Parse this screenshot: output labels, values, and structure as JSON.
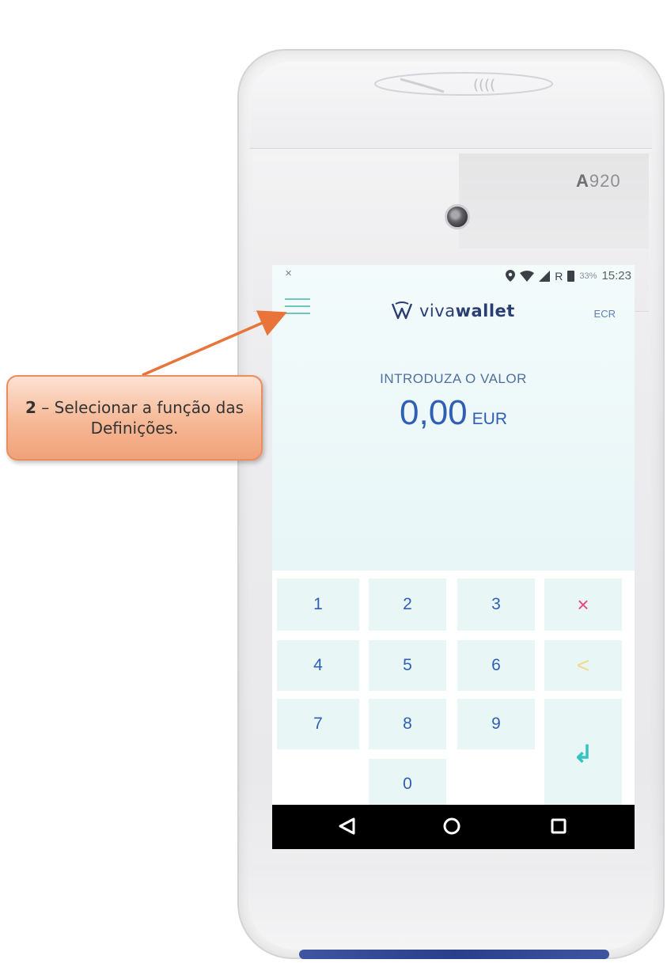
{
  "device": {
    "model_prefix": "A",
    "model_suffix": "920"
  },
  "status_bar": {
    "left_icon": "signal-off-icon",
    "icons": [
      "location-icon",
      "wifi-icon",
      "cell-signal-icon",
      "battery-icon"
    ],
    "network": "R",
    "battery": "33%",
    "time": "15:23"
  },
  "header": {
    "menu_icon": "hamburger-menu-icon",
    "brand_light": "viva",
    "brand_bold": "wallet",
    "ecr_label": "ECR"
  },
  "amount_entry": {
    "prompt": "INTRODUZA O VALOR",
    "value": "0,00",
    "currency": "EUR"
  },
  "keypad": {
    "keys": {
      "k1": "1",
      "k2": "2",
      "k3": "3",
      "k4": "4",
      "k5": "5",
      "k6": "6",
      "k7": "7",
      "k8": "8",
      "k9": "9",
      "k0": "0",
      "clear": "×",
      "backspace": "<",
      "enter": "↲"
    }
  },
  "nav_bar": {
    "icons": [
      "back-icon",
      "home-icon",
      "recents-icon"
    ]
  },
  "callout": {
    "step": "2",
    "text": " – Selecionar a função das Definições."
  },
  "colors": {
    "callout_fill": "#f6b896",
    "callout_border": "#eb8d5c",
    "arrow": "#e8743a",
    "brand_navy": "#2a3e72",
    "amount_blue": "#2f5fb5",
    "accent_teal": "#35c4c0",
    "clear_pink": "#e3477f"
  }
}
